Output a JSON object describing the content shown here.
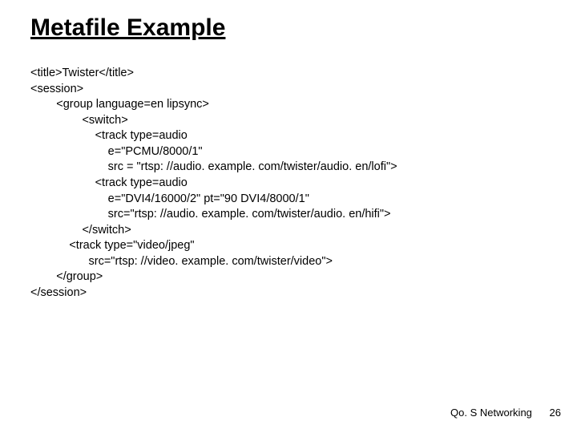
{
  "title": "Metafile Example",
  "code": {
    "l1": "<title>Twister</title>",
    "l2": "<session>",
    "l3": "        <group language=en lipsync>",
    "l4": "                <switch>",
    "l5": "                    <track type=audio",
    "l6": "                        e=\"PCMU/8000/1\"",
    "l7": "                        src = \"rtsp: //audio. example. com/twister/audio. en/lofi\">",
    "l8": "                    <track type=audio",
    "l9": "                        e=\"DVI4/16000/2\" pt=\"90 DVI4/8000/1\"",
    "l10": "                        src=\"rtsp: //audio. example. com/twister/audio. en/hifi\">",
    "l11": "                </switch>",
    "l12": "            <track type=\"video/jpeg\"",
    "l13": "                  src=\"rtsp: //video. example. com/twister/video\">",
    "l14": "        </group>",
    "l15": "</session>"
  },
  "footer": {
    "label": "Qo. S Networking",
    "page": "26"
  }
}
